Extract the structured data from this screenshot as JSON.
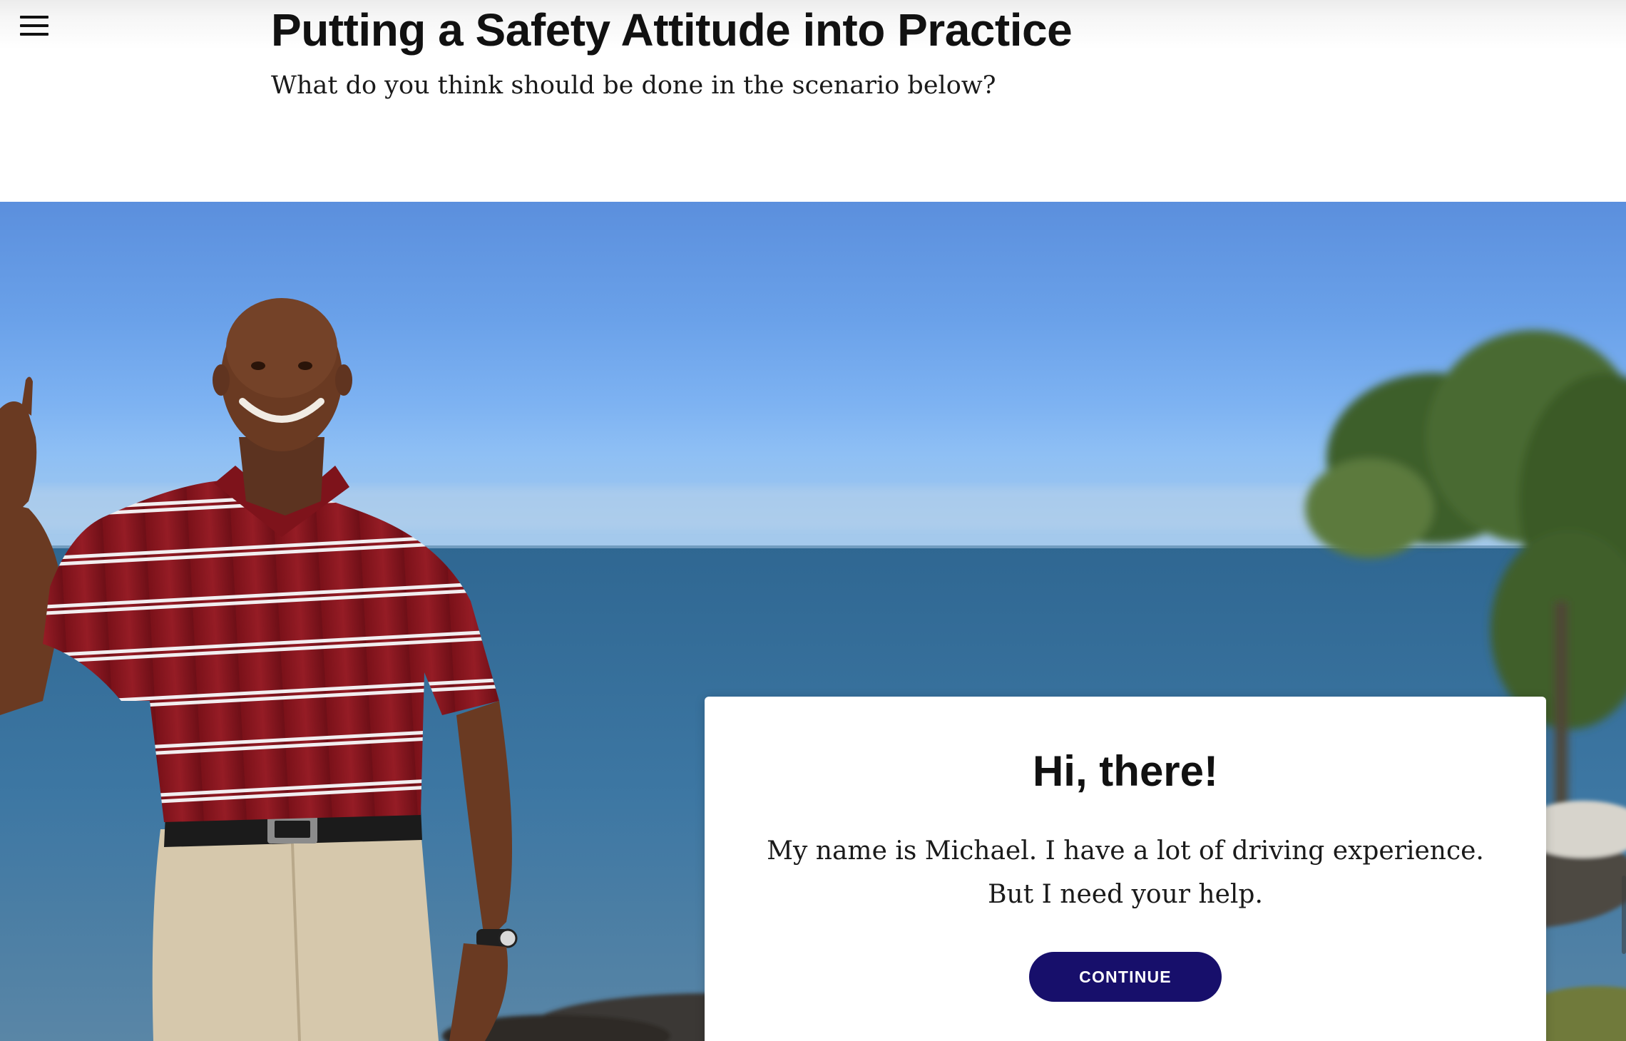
{
  "header": {
    "title": "Putting a Safety Attitude into Practice",
    "subtitle": "What do you think should be done in the scenario below?"
  },
  "menu": {
    "icon": "hamburger-menu-icon"
  },
  "scenario": {
    "character_image": "man-waving-red-striped-polo",
    "background_image": "ocean-shoreline-rocks-trees",
    "card": {
      "heading": "Hi, there!",
      "text": "My name is Michael. I have a lot of driving experience. But I need your help.",
      "button_label": "CONTINUE"
    }
  },
  "colors": {
    "button": "#170f6b",
    "shirt": "#8c1a22",
    "sky": "#6aa1e9",
    "sea": "#3f6e97"
  }
}
